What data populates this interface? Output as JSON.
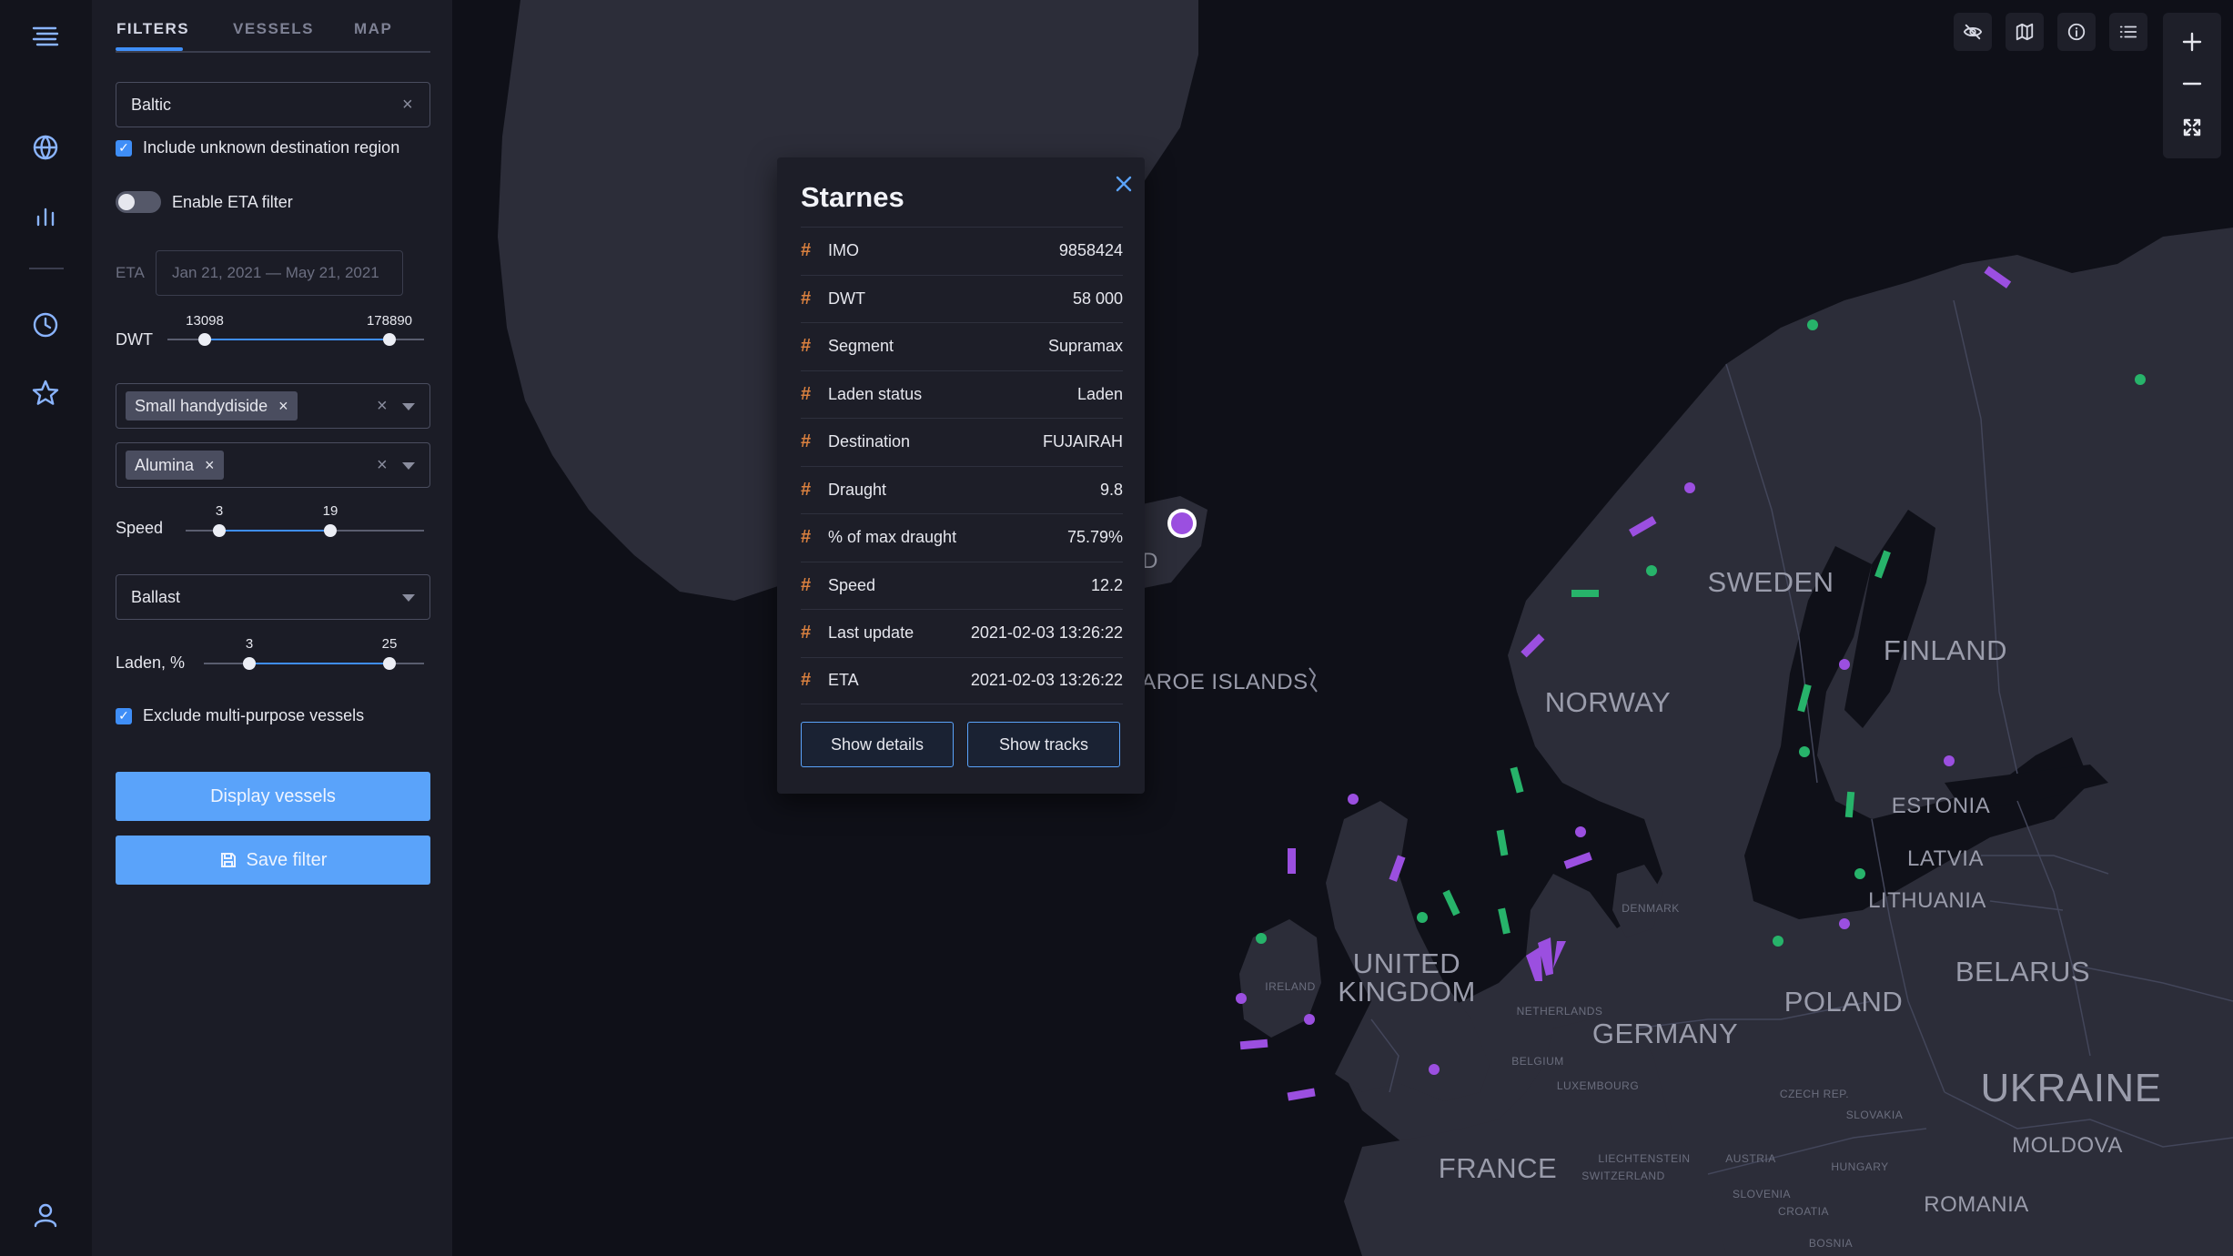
{
  "tabs": [
    {
      "label": "FILTERS"
    },
    {
      "label": "VESSELS"
    },
    {
      "label": "MAP"
    }
  ],
  "filters": {
    "region_value": "Baltic",
    "include_unknown_label": "Include unknown destination region",
    "eta_toggle_label": "Enable ETA filter",
    "eta_label": "ETA",
    "eta_range": "Jan 21, 2021 — May 21, 2021",
    "dwt": {
      "label": "DWT",
      "min": "13098",
      "max": "178890"
    },
    "segment_chip": "Small handydiside",
    "cargo_chip": "Alumina",
    "speed": {
      "label": "Speed",
      "min": "3",
      "max": "19"
    },
    "status_value": "Ballast",
    "laden": {
      "label": "Laden, %",
      "min": "3",
      "max": "25"
    },
    "exclude_multi_label": "Exclude multi-purpose vessels",
    "display_button": "Display vessels",
    "save_button": "Save filter"
  },
  "popup": {
    "title": "Starnes",
    "rows": [
      {
        "label": "IMO",
        "value": "9858424"
      },
      {
        "label": "DWT",
        "value": "58 000"
      },
      {
        "label": "Segment",
        "value": "Supramax"
      },
      {
        "label": "Laden status",
        "value": "Laden"
      },
      {
        "label": "Destination",
        "value": "FUJAIRAH"
      },
      {
        "label": "Draught",
        "value": "9.8"
      },
      {
        "label": "% of max draught",
        "value": "75.79%"
      },
      {
        "label": "Speed",
        "value": "12.2"
      },
      {
        "label": "Last update",
        "value": "2021-02-03 13:26:22"
      },
      {
        "label": "ETA",
        "value": "2021-02-03 13:26:22"
      }
    ],
    "details_button": "Show details",
    "tracks_button": "Show tracks"
  },
  "map_labels": {
    "sweden": "SWEDEN",
    "finland": "FINLAND",
    "norway": "NORWAY",
    "faroe": "FAROE ISLANDS",
    "iceland_partial": "D",
    "estonia": "ESTONIA",
    "latvia": "LATVIA",
    "lithuania": "LITHUANIA",
    "belarus": "BELARUS",
    "poland": "POLAND",
    "germany": "GERMANY",
    "uk_line1": "UNITED",
    "uk_line2": "KINGDOM",
    "ireland": "IRELAND",
    "ukraine": "UKRAINE",
    "moldova": "MOLDOVA",
    "romania": "ROMANIA",
    "france": "FRANCE",
    "denmark": "DENMARK",
    "netherlands": "NETHERLANDS",
    "belgium": "BELGIUM",
    "luxembourg": "LUXEMBOURG",
    "czech": "CZECH REP.",
    "slovakia": "SLOVAKIA",
    "austria": "AUSTRIA",
    "hungary": "HUNGARY",
    "liechtenstein": "LIECHTENSTEIN",
    "switzerland": "SWITZERLAND",
    "slovenia": "SLOVENIA",
    "croatia": "CROATIA",
    "bosnia": "BOSNIA"
  },
  "colors": {
    "accent": "#3f8ef7",
    "button": "#5aa3fa",
    "vessel_laden": "#9b4fe0",
    "vessel_ballast": "#27b36a",
    "hash_marker": "#d9803f",
    "land": "#2c2d39",
    "sea": "#0f1018"
  },
  "icons": {
    "rail": [
      "menu-lines-icon",
      "globe-icon",
      "bar-chart-icon",
      "clock-icon",
      "star-icon",
      "user-icon"
    ],
    "map_controls": [
      "eye-off-icon",
      "map-icon",
      "info-icon",
      "list-icon",
      "plus-icon",
      "minus-icon",
      "expand-icon"
    ]
  }
}
